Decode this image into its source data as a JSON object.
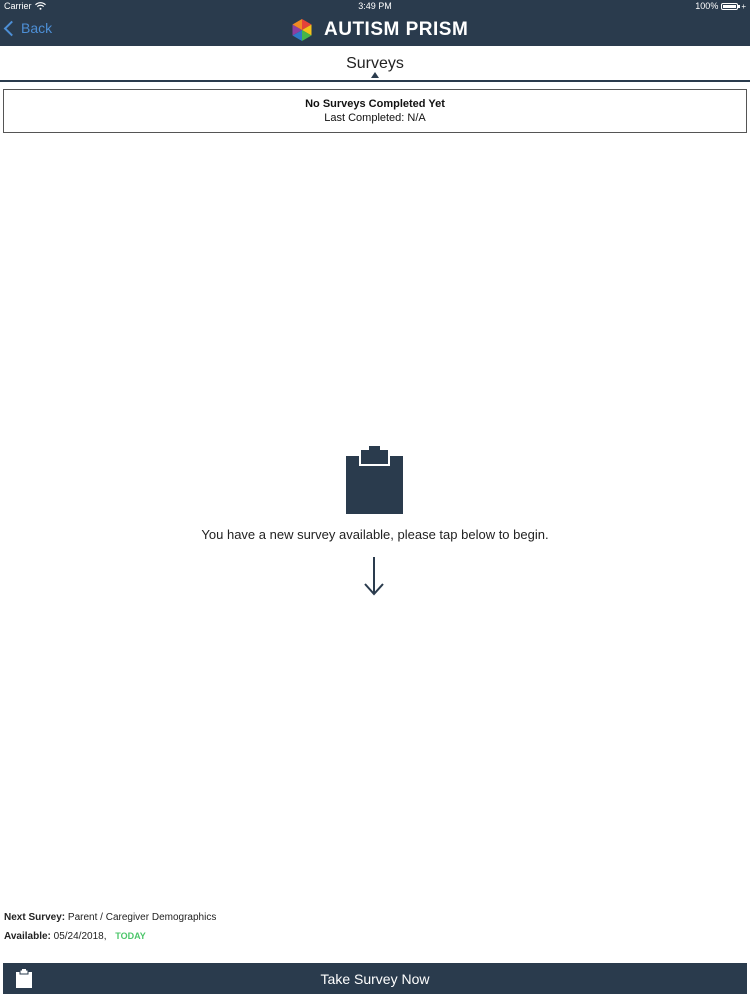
{
  "status_bar": {
    "carrier": "Carrier",
    "time": "3:49 PM",
    "battery": "100%",
    "wifi_icon": "wifi-icon",
    "battery_icon": "battery-icon"
  },
  "nav": {
    "back_label": "Back",
    "app_title": "AUTISM PRISM",
    "logo_icon": "prism-logo-icon"
  },
  "page": {
    "title": "Surveys"
  },
  "status_box": {
    "title": "No Surveys Completed Yet",
    "last_completed": "Last Completed: N/A"
  },
  "main": {
    "icon": "clipboard-icon",
    "prompt": "You have a new survey available, please tap below to begin.",
    "arrow_icon": "arrow-down-icon"
  },
  "footer": {
    "next_survey_label": "Next Survey:",
    "next_survey_value": "Parent / Caregiver Demographics",
    "available_label": "Available:",
    "available_value": "05/24/2018,",
    "today": "TODAY"
  },
  "take_survey_button": {
    "label": "Take Survey Now",
    "icon": "clipboard-icon"
  },
  "colors": {
    "header_bg": "#2a3b4d",
    "back_link": "#4d8fd6",
    "today": "#4cc66a",
    "logo_red": "#e5423a",
    "logo_yellow": "#f5c21b",
    "logo_green": "#46b64a",
    "logo_blue": "#2f79c9",
    "logo_purple": "#8e3fa0",
    "logo_orange": "#f08a24"
  }
}
